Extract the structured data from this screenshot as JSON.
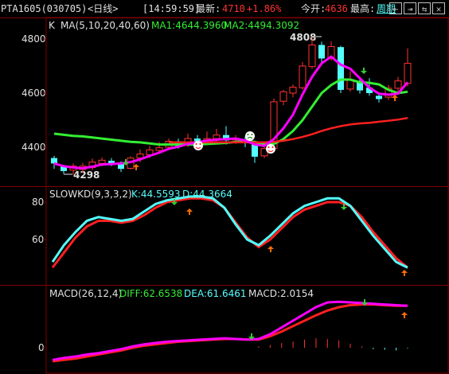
{
  "header": {
    "symbol": "PTA1605(030705)",
    "period_label": "<日线>",
    "time": "[14:59:59]",
    "latest_label": "最新:",
    "latest_value": "4710",
    "change_pct": "+1.86%",
    "open_label": "今开:",
    "open_value": "4636",
    "high_label": "最高:",
    "period_link": "周期",
    "buttons": [
      "⇤",
      "⇥",
      "⇆",
      "✕"
    ]
  },
  "colors": {
    "bg": "#000000",
    "grid": "#800000",
    "up": "#ff3232",
    "down": "#54ffff",
    "ma5": "#ff00ff",
    "ma10": "#33ee33",
    "ma20": "#ff2020",
    "k": "#54ffff",
    "d": "#ff2020"
  },
  "main_panel": {
    "title": "K",
    "ma_label": "MA(5,10,20,40,60)",
    "ma1_text": "MA1:4644.3960",
    "ma2_text": "MA2:4494.3092",
    "y_ticks": [
      "4800",
      "4600",
      "4400"
    ],
    "high_annotation": "4808",
    "low_annotation": "4298"
  },
  "kd_panel": {
    "title": "SLOWKD(9,3,3,2)",
    "k_text": "K:44.5593",
    "d_text": "D:44.3664",
    "y_ticks": [
      "80",
      "60"
    ]
  },
  "macd_panel": {
    "title": "MACD(26,12,4)",
    "diff_text": "DIFF:62.6538",
    "dea_text": "DEA:61.6461",
    "macd_text": "MACD:2.0154",
    "y_ticks": [
      "0"
    ]
  },
  "chart_data": {
    "type": "candlestick",
    "candles": [
      {
        "o": 4360,
        "c": 4340,
        "h": 4368,
        "l": 4320
      },
      {
        "o": 4328,
        "c": 4312,
        "h": 4335,
        "l": 4302
      },
      {
        "o": 4315,
        "c": 4330,
        "h": 4340,
        "l": 4298
      },
      {
        "o": 4318,
        "c": 4330,
        "h": 4342,
        "l": 4305
      },
      {
        "o": 4325,
        "c": 4345,
        "h": 4358,
        "l": 4315
      },
      {
        "o": 4340,
        "c": 4352,
        "h": 4362,
        "l": 4330
      },
      {
        "o": 4350,
        "c": 4338,
        "h": 4360,
        "l": 4330
      },
      {
        "o": 4338,
        "c": 4320,
        "h": 4348,
        "l": 4308
      },
      {
        "o": 4322,
        "c": 4360,
        "h": 4366,
        "l": 4318
      },
      {
        "o": 4360,
        "c": 4375,
        "h": 4392,
        "l": 4345
      },
      {
        "o": 4372,
        "c": 4390,
        "h": 4405,
        "l": 4360
      },
      {
        "o": 4388,
        "c": 4398,
        "h": 4420,
        "l": 4375
      },
      {
        "o": 4400,
        "c": 4422,
        "h": 4432,
        "l": 4390
      },
      {
        "o": 4422,
        "c": 4405,
        "h": 4432,
        "l": 4395
      },
      {
        "o": 4410,
        "c": 4432,
        "h": 4450,
        "l": 4400
      },
      {
        "o": 4432,
        "c": 4418,
        "h": 4445,
        "l": 4405
      },
      {
        "o": 4418,
        "c": 4432,
        "h": 4458,
        "l": 4408
      },
      {
        "o": 4432,
        "c": 4445,
        "h": 4468,
        "l": 4420
      },
      {
        "o": 4445,
        "c": 4425,
        "h": 4478,
        "l": 4410
      },
      {
        "o": 4428,
        "c": 4430,
        "h": 4445,
        "l": 4412
      },
      {
        "o": 4430,
        "c": 4418,
        "h": 4440,
        "l": 4400
      },
      {
        "o": 4410,
        "c": 4365,
        "h": 4420,
        "l": 4342
      },
      {
        "o": 4368,
        "c": 4395,
        "h": 4405,
        "l": 4360
      },
      {
        "o": 4395,
        "c": 4568,
        "h": 4580,
        "l": 4390
      },
      {
        "o": 4570,
        "c": 4605,
        "h": 4612,
        "l": 4555
      },
      {
        "o": 4600,
        "c": 4622,
        "h": 4632,
        "l": 4585
      },
      {
        "o": 4620,
        "c": 4700,
        "h": 4715,
        "l": 4612
      },
      {
        "o": 4698,
        "c": 4778,
        "h": 4808,
        "l": 4690
      },
      {
        "o": 4778,
        "c": 4728,
        "h": 4790,
        "l": 4710
      },
      {
        "o": 4728,
        "c": 4772,
        "h": 4792,
        "l": 4720
      },
      {
        "o": 4770,
        "c": 4612,
        "h": 4775,
        "l": 4600
      },
      {
        "o": 4615,
        "c": 4650,
        "h": 4680,
        "l": 4605
      },
      {
        "o": 4640,
        "c": 4610,
        "h": 4650,
        "l": 4598
      },
      {
        "o": 4620,
        "c": 4600,
        "h": 4655,
        "l": 4590
      },
      {
        "o": 4590,
        "c": 4578,
        "h": 4595,
        "l": 4565
      },
      {
        "o": 4585,
        "c": 4618,
        "h": 4630,
        "l": 4575
      },
      {
        "o": 4618,
        "c": 4645,
        "h": 4660,
        "l": 4605
      },
      {
        "o": 4636,
        "c": 4710,
        "h": 4765,
        "l": 4625
      }
    ],
    "ma5": [
      4340,
      4330,
      4325,
      4322,
      4328,
      4336,
      4338,
      4340,
      4345,
      4355,
      4368,
      4380,
      4394,
      4402,
      4412,
      4418,
      4425,
      4428,
      4430,
      4432,
      4425,
      4410,
      4405,
      4430,
      4470,
      4520,
      4595,
      4660,
      4710,
      4735,
      4705,
      4690,
      4655,
      4620,
      4598,
      4594,
      4598,
      4640
    ],
    "ma10": [
      4450,
      4446,
      4442,
      4440,
      4436,
      4432,
      4428,
      4424,
      4420,
      4418,
      4414,
      4410,
      4410,
      4410,
      4410,
      4410,
      4412,
      4414,
      4416,
      4420,
      4422,
      4420,
      4410,
      4412,
      4430,
      4460,
      4500,
      4550,
      4600,
      4630,
      4650,
      4650,
      4640,
      4638,
      4632,
      4612,
      4600,
      4605
    ],
    "ma20": [
      null,
      null,
      null,
      null,
      null,
      null,
      null,
      null,
      null,
      null,
      null,
      null,
      4418,
      4418,
      4418,
      4418,
      4418,
      4418,
      4418,
      4418,
      4418,
      4418,
      4418,
      4420,
      4424,
      4430,
      4438,
      4448,
      4460,
      4470,
      4478,
      4484,
      4488,
      4490,
      4494,
      4498,
      4502,
      4508
    ],
    "kd_k": [
      48,
      57,
      64,
      70,
      72,
      71,
      70,
      71,
      75,
      79,
      81,
      82,
      83,
      83,
      82,
      77,
      68,
      60,
      57,
      62,
      68,
      74,
      78,
      80,
      82,
      82,
      78,
      70,
      62,
      55,
      48,
      45
    ],
    "kd_d": [
      45,
      53,
      61,
      67,
      70,
      70,
      69,
      70,
      73,
      77,
      80,
      81,
      82,
      82,
      81,
      77,
      69,
      61,
      56,
      60,
      66,
      72,
      76,
      78,
      80,
      80,
      78,
      72,
      64,
      57,
      50,
      45
    ],
    "macd_diff": [
      -18,
      -15,
      -13,
      -10,
      -8,
      -5,
      -2,
      2,
      5,
      7,
      9,
      10,
      11,
      12,
      13,
      14,
      13,
      12,
      13,
      20,
      30,
      40,
      50,
      60,
      67,
      68,
      67,
      66,
      65,
      64,
      63,
      62
    ],
    "macd_dea": [
      -20,
      -18,
      -16,
      -13,
      -10,
      -7,
      -4,
      0,
      3,
      5,
      7,
      9,
      10,
      11,
      12,
      13,
      13,
      12,
      12,
      17,
      24,
      32,
      40,
      48,
      55,
      60,
      63,
      64,
      64,
      63,
      62,
      62
    ],
    "macd_bar": [
      0,
      0,
      0,
      0,
      0,
      0,
      0,
      0,
      0,
      0,
      0,
      0,
      0,
      0,
      0,
      0,
      0,
      0,
      2,
      4,
      7,
      9,
      12,
      14,
      13,
      11,
      6,
      2,
      -2,
      -3,
      -4,
      -1
    ]
  }
}
